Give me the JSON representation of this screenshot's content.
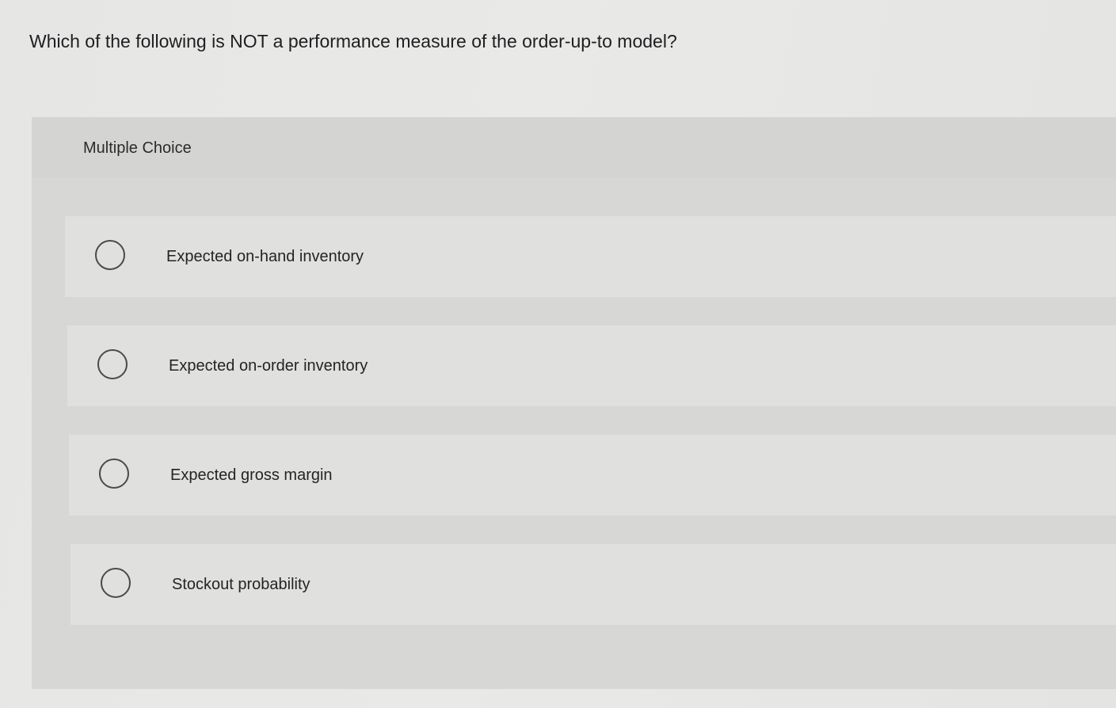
{
  "question": {
    "text": "Which of the following is NOT a performance measure of the order-up-to model?"
  },
  "panel": {
    "header_label": "Multiple Choice",
    "options": [
      {
        "label": "Expected on-hand inventory",
        "selected": false
      },
      {
        "label": "Expected on-order inventory",
        "selected": false
      },
      {
        "label": "Expected gross margin",
        "selected": false
      },
      {
        "label": "Stockout probability",
        "selected": false
      }
    ]
  },
  "icons": {
    "radio": "radio-button-unchecked-icon"
  },
  "colors": {
    "background": "#e7e7e5",
    "panel": "#d7d7d5",
    "option_row": "#e0e0de",
    "text": "#1f1f22",
    "radio_border": "#4a4a4e"
  }
}
